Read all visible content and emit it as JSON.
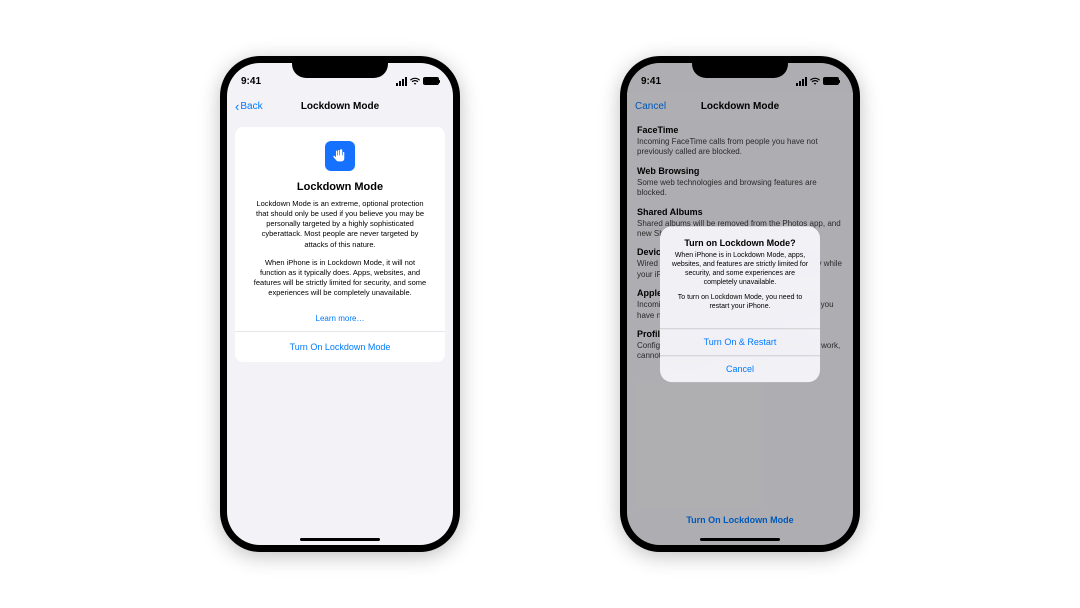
{
  "status": {
    "time": "9:41"
  },
  "phone1": {
    "nav": {
      "back": "Back",
      "title": "Lockdown Mode"
    },
    "card": {
      "title": "Lockdown Mode",
      "p1": "Lockdown Mode is an extreme, optional protection that should only be used if you believe you may be personally targeted by a highly sophisticated cyberattack. Most people are never targeted by attacks of this nature.",
      "p2": "When iPhone is in Lockdown Mode, it will not function as it typically does. Apps, websites, and features will be strictly limited for security, and some experiences will be completely unavailable.",
      "learn": "Learn more…",
      "turnOn": "Turn On Lockdown Mode"
    }
  },
  "phone2": {
    "nav": {
      "cancel": "Cancel",
      "title": "Lockdown Mode"
    },
    "sections": {
      "facetime": {
        "title": "FaceTime",
        "body": "Incoming FaceTime calls from people you have not previously called are blocked."
      },
      "web": {
        "title": "Web Browsing",
        "body": "Some web technologies and browsing features are blocked."
      },
      "shared": {
        "title": "Shared Albums",
        "body": "Shared albums will be removed from the Photos app, and new Shared Album invitations will be blocked."
      },
      "device": {
        "title": "Device Connections",
        "body": "Wired connections with another device or accessory while your iPhone is locked are blocked."
      },
      "apple": {
        "title": "Apple Services",
        "body": "Incoming invitations for Apple Services from people you have not previously invited are blocked."
      },
      "profiles": {
        "title": "Profiles",
        "body": "Configuration profiles, such as profiles for school or work, cannot be installed."
      }
    },
    "turnOn": "Turn On Lockdown Mode",
    "alert": {
      "title": "Turn on Lockdown Mode?",
      "msg1": "When iPhone is in Lockdown Mode, apps, websites, and features are strictly limited for security, and some experiences are completely unavailable.",
      "msg2": "To turn on Lockdown Mode, you need to restart your iPhone.",
      "confirm": "Turn On & Restart",
      "cancel": "Cancel"
    }
  }
}
